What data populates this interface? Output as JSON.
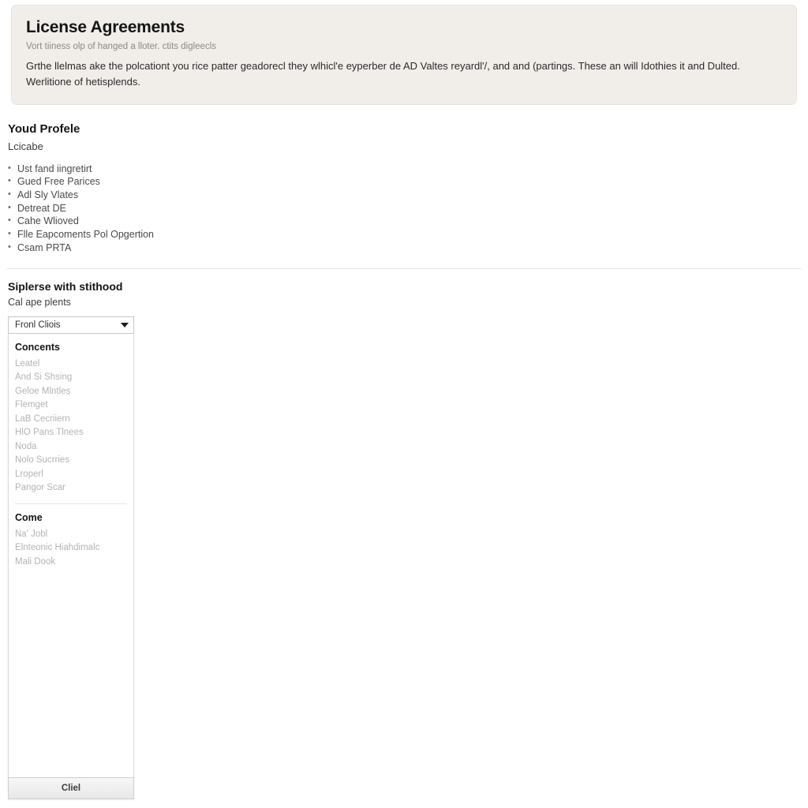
{
  "banner": {
    "title": "License Agreements",
    "subtitle": "Vort tiiness olp of hanged a lloter. ctits digleecls",
    "body": "Grthe llelmas ake the polcationt you rice patter geadorecl they wlhicl'e eyperber de AD Valtes reyardl'/, and and (partings. These an will Idothies it and Dulted. Werlitione of hetisplends."
  },
  "profile": {
    "title": "Youd Profele",
    "subtitle": "Lcicabe",
    "items": [
      "Ust fand iingretirt",
      "Gued Free Parices",
      "Adl Sly Vlates",
      "Detreat DE",
      "Cahe Wlioved",
      "Flle Eapcoments Pol Opgertion",
      "Csam PRTA"
    ]
  },
  "select_section": {
    "title": "Siplerse with stithood",
    "subtitle": "Cal ape plents",
    "combo": {
      "value": "Fronl Cliois",
      "caret_icon": "chevron-down-icon"
    },
    "groups": [
      {
        "label": "Concents",
        "options": [
          "Leatel",
          "And Si Shsing",
          "Geloe Mlntles",
          "Flemget",
          "LaB Cecriiern",
          "HlO Pans Tlnees",
          "Noda",
          "Nolo Sucrries",
          "Lroperl",
          "Pangor Scar"
        ]
      },
      {
        "label": "Come",
        "options": [
          "Na' Jobl",
          "Elnteonic Hiahdimalc",
          "Mali Dook"
        ]
      }
    ],
    "footer_button": "Cliel"
  }
}
